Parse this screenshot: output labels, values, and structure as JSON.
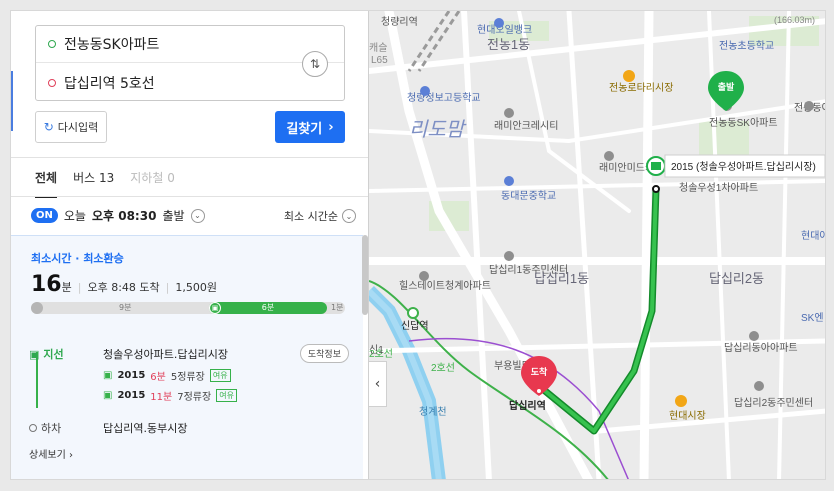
{
  "search": {
    "origin": "전농동SK아파트",
    "destination": "답십리역 5호선",
    "reset_label": "다시입력",
    "find_label": "길찾기"
  },
  "tabs": [
    {
      "label": "전체"
    },
    {
      "label": "버스 13"
    },
    {
      "label": "지하철 0"
    }
  ],
  "departure": {
    "on_badge": "ON",
    "prefix": "오늘",
    "time": "오후 08:30",
    "suffix": "출발",
    "sort": "최소 시간순"
  },
  "route": {
    "tag": "최소시간 · 최소환승",
    "duration_num": "16",
    "duration_unit": "분",
    "arrival": "오후 8:48 도착",
    "fare": "1,500원",
    "segments": {
      "walk1": "9분",
      "bus": "6분",
      "walk2": "1분"
    },
    "board_label": "지선",
    "board_stop": "청솔우성아파트.답십리시장",
    "arrival_info_btn": "도착정보",
    "buses": [
      {
        "number": "2015",
        "minutes": "6분",
        "stops": "5정류장",
        "status": "여유"
      },
      {
        "number": "2015",
        "minutes": "11분",
        "stops": "7정류장",
        "status": "여유"
      }
    ],
    "alight_label": "하차",
    "alight_stop": "답십리역.동부시장",
    "detail_link": "상세보기"
  },
  "map": {
    "labels": {
      "cheongnyangni": "청량리역",
      "hyundai_bank": "현대오일뱅크",
      "jeonnong1": "전농1동",
      "jeonnong_elem": "전농초등학교",
      "cheongnyang_high": "청량정보고등학교",
      "rimang": "리도맘",
      "ramian_crescent": "래미안크레시티",
      "jeonnong_rotary": "전농로타리시장",
      "skapt": "전농동SK아파트",
      "jeonnong_apt": "전농동아아파트",
      "ramian_midcarville": "래미안미드카운티",
      "cheongsol": "청솔우성1차아파트",
      "dongdaemun_school": "동대문중학교",
      "dapsimni1": "답십리1동주민센터",
      "dapsimni1_big": "답십리1동",
      "dapsimni2": "답십리2동",
      "hillstate": "힐스테이트청계아파트",
      "sindap": "신답역",
      "dapsimni_dong_a": "답십리동아아파트",
      "sk": "SK엔",
      "hyundai": "현대아",
      "dapsimni2_center": "답십리2동주민센터",
      "hyundai_market": "현대시장",
      "dapsimni_station": "답십리역",
      "bupyeong": "부용빌딩",
      "cheonggye": "청계천",
      "line2": "2호선",
      "line2b": "2호선",
      "line_l65": "L65",
      "sin1": "신1",
      "top_right_num": "(166.03m)",
      "chaen": "캐슬"
    },
    "start_marker": "출발",
    "end_marker": "도착",
    "bus_stop_label": "2015 (청솔우성아파트.답십리시장)"
  }
}
